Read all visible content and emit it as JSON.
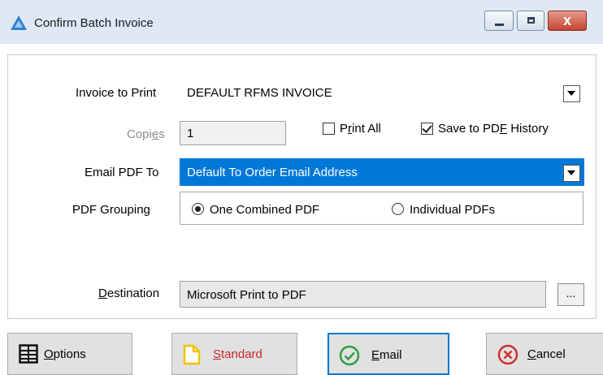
{
  "window": {
    "title": "Confirm Batch Invoice",
    "icon": "app-logo-icon",
    "controls": {
      "minimize": "minimize-icon",
      "maximize": "maximize-icon",
      "close_glyph": "x"
    }
  },
  "form": {
    "invoice_label": "Invoice to Print",
    "invoice_value": "DEFAULT RFMS INVOICE",
    "copies_label": "Copies",
    "copies_value": "1",
    "print_all_label": "Print All",
    "print_all_checked": false,
    "save_pdf_label": "Save to PDF History",
    "save_pdf_checked": true,
    "email_label": "Email PDF To",
    "email_value": "Default To Order Email Address",
    "grouping_label": "PDF Grouping",
    "grouping_options": [
      "One Combined PDF",
      "Individual PDFs"
    ],
    "grouping_selected": "One Combined PDF",
    "destination_label": "Destination",
    "destination_value": "Microsoft Print to PDF",
    "browse_label": "..."
  },
  "buttons": {
    "options": "Options",
    "standard": "Standard",
    "email": "Email",
    "cancel": "Cancel"
  },
  "colors": {
    "titlebar": "#dfe9f5",
    "selection_blue": "#0078d7",
    "standard_text": "#c62828",
    "email_icon_green": "#2e9e44",
    "cancel_icon_red": "#d32f2f",
    "standard_icon_yellow": "#f2c200"
  }
}
